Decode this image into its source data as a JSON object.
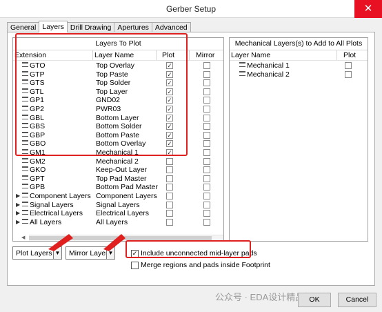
{
  "window": {
    "title": "Gerber Setup",
    "close_glyph": "✕"
  },
  "tabs": [
    {
      "label": "General",
      "active": false
    },
    {
      "label": "Layers",
      "active": true
    },
    {
      "label": "Drill Drawing",
      "active": false
    },
    {
      "label": "Apertures",
      "active": false
    },
    {
      "label": "Advanced",
      "active": false
    }
  ],
  "layers_panel": {
    "title": "Layers To Plot",
    "columns": {
      "extension": "Extension",
      "layer_name": "Layer Name",
      "plot": "Plot",
      "mirror": "Mirror"
    },
    "rows": [
      {
        "ext": "GTO",
        "name": "Top Overlay",
        "plot": true,
        "mirror": false,
        "group": false
      },
      {
        "ext": "GTP",
        "name": "Top Paste",
        "plot": true,
        "mirror": false,
        "group": false
      },
      {
        "ext": "GTS",
        "name": "Top Solder",
        "plot": true,
        "mirror": false,
        "group": false
      },
      {
        "ext": "GTL",
        "name": "Top Layer",
        "plot": true,
        "mirror": false,
        "group": false
      },
      {
        "ext": "GP1",
        "name": "GND02",
        "plot": true,
        "mirror": false,
        "group": false
      },
      {
        "ext": "GP2",
        "name": "PWR03",
        "plot": true,
        "mirror": false,
        "group": false
      },
      {
        "ext": "GBL",
        "name": "Bottom Layer",
        "plot": true,
        "mirror": false,
        "group": false
      },
      {
        "ext": "GBS",
        "name": "Bottom Solder",
        "plot": true,
        "mirror": false,
        "group": false
      },
      {
        "ext": "GBP",
        "name": "Bottom Paste",
        "plot": true,
        "mirror": false,
        "group": false
      },
      {
        "ext": "GBO",
        "name": "Bottom Overlay",
        "plot": true,
        "mirror": false,
        "group": false
      },
      {
        "ext": "GM1",
        "name": "Mechanical 1",
        "plot": true,
        "mirror": false,
        "group": false
      },
      {
        "ext": "GM2",
        "name": "Mechanical 2",
        "plot": false,
        "mirror": false,
        "group": false
      },
      {
        "ext": "GKO",
        "name": "Keep-Out Layer",
        "plot": false,
        "mirror": false,
        "group": false
      },
      {
        "ext": "GPT",
        "name": "Top Pad Master",
        "plot": false,
        "mirror": false,
        "group": false
      },
      {
        "ext": "GPB",
        "name": "Bottom Pad Master",
        "plot": false,
        "mirror": false,
        "group": false
      },
      {
        "ext": "Component Layers",
        "name": "Component Layers",
        "plot": false,
        "mirror": false,
        "group": true
      },
      {
        "ext": "Signal Layers",
        "name": "Signal Layers",
        "plot": false,
        "mirror": false,
        "group": true
      },
      {
        "ext": "Electrical Layers",
        "name": "Electrical Layers",
        "plot": false,
        "mirror": false,
        "group": true
      },
      {
        "ext": "All Layers",
        "name": "All Layers",
        "plot": false,
        "mirror": false,
        "group": true
      }
    ]
  },
  "mech_panel": {
    "title": "Mechanical Layers(s) to Add to All Plots",
    "columns": {
      "layer_name": "Layer Name",
      "plot": "Plot"
    },
    "rows": [
      {
        "name": "Mechanical 1",
        "plot": false
      },
      {
        "name": "Mechanical 2",
        "plot": false
      }
    ]
  },
  "controls": {
    "plot_layers": "Plot Layers",
    "mirror_layers": "Mirror Layers",
    "include_unconnected": {
      "label": "Include unconnected mid-layer pads",
      "checked": true
    },
    "merge_regions": {
      "label": "Merge regions and pads inside Footprint",
      "checked": false
    }
  },
  "buttons": {
    "ok": "OK",
    "cancel": "Cancel"
  },
  "watermark": "公众号 · EDA设计精品智汇馆",
  "glyphs": {
    "check": "✓",
    "dropdown": "▼",
    "expand": "▶",
    "scroll_left": "◀"
  },
  "colors": {
    "highlight": "#e0201f"
  }
}
